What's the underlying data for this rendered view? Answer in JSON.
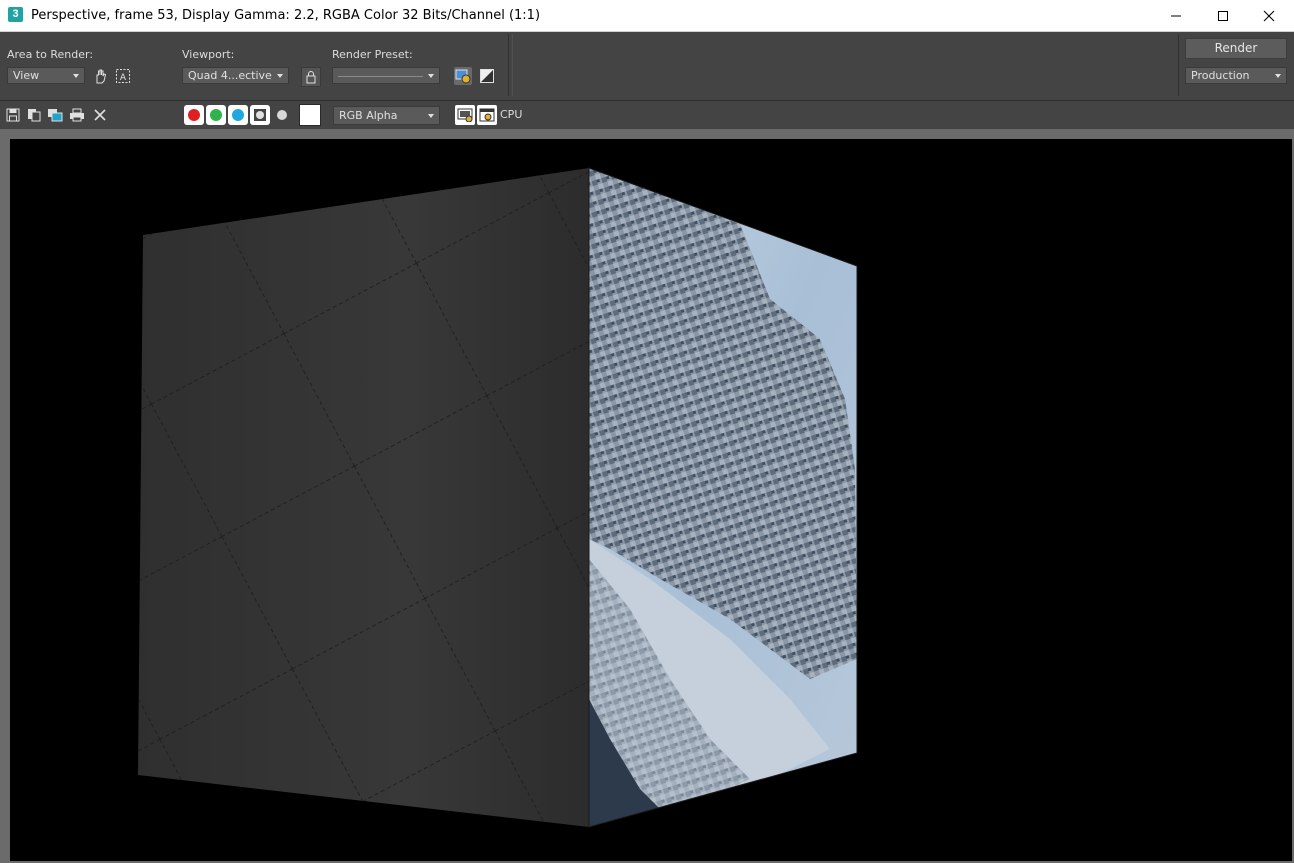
{
  "window": {
    "app_icon": "3",
    "title": "Perspective, frame 53, Display Gamma: 2.2, RGBA Color 32 Bits/Channel (1:1)",
    "controls": [
      "minimize-icon",
      "maximize-icon",
      "close-icon"
    ]
  },
  "top_panel": {
    "area_to_render": {
      "label": "Area to Render:",
      "value": "View"
    },
    "viewport": {
      "label": "Viewport:",
      "value": "Quad 4...ective"
    },
    "render_preset": {
      "label": "Render Preset:",
      "value": ""
    },
    "render_button": "Render",
    "render_mode": "Production"
  },
  "toolbar": {
    "icons": [
      "save-icon",
      "copy-icon",
      "clone-icon",
      "print-icon",
      "clear-icon"
    ],
    "channels": {
      "red": "#e02020",
      "green": "#2fb34a",
      "blue": "#1fa8e0"
    },
    "display_channel": "RGB Alpha",
    "cpu_label": "CPU"
  },
  "render": {
    "background": "#000000",
    "subject": "textured-cube"
  }
}
